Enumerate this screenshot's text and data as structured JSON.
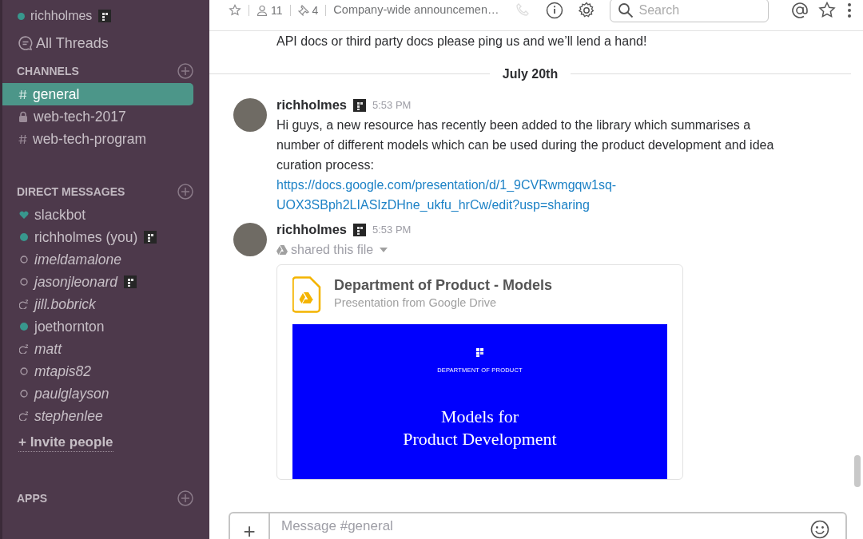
{
  "sidebar": {
    "user": {
      "name": "richholmes",
      "online": true,
      "badge": true
    },
    "all_threads": "All Threads",
    "channels_header": "CHANNELS",
    "channels": [
      {
        "name": "general",
        "kind": "public",
        "selected": true
      },
      {
        "name": "web-tech-2017",
        "kind": "private",
        "selected": false
      },
      {
        "name": "web-tech-program",
        "kind": "public",
        "selected": false
      }
    ],
    "dm_header": "DIRECT MESSAGES",
    "direct_messages": [
      {
        "name": "slackbot",
        "kind": "bot",
        "badge": false
      },
      {
        "name": "richholmes (you)",
        "kind": "active",
        "badge": true
      },
      {
        "name": "imeldamalone",
        "kind": "away",
        "badge": false
      },
      {
        "name": "jasonjleonard",
        "kind": "away",
        "badge": true
      },
      {
        "name": "jill.bobrick",
        "kind": "snoozed",
        "badge": false
      },
      {
        "name": "joethornton",
        "kind": "active",
        "badge": false
      },
      {
        "name": "matt",
        "kind": "snoozed",
        "badge": false
      },
      {
        "name": "mtapis82",
        "kind": "away",
        "badge": false
      },
      {
        "name": "paulglayson",
        "kind": "away",
        "badge": false
      },
      {
        "name": "stephenlee",
        "kind": "snoozed",
        "badge": false
      }
    ],
    "invite": {
      "icon": "+",
      "label": "Invite people"
    },
    "apps_header": "APPS"
  },
  "header": {
    "members": "11",
    "pins": "4",
    "topic": "Company-wide announcemen…",
    "search_placeholder": "Search"
  },
  "messages": {
    "partial_text": "API docs or third party docs please ping us and we’ll lend a hand!",
    "date_divider": "July 20th",
    "items": [
      {
        "kind": "text",
        "author": "richholmes",
        "time": "5:53 PM",
        "text": "Hi guys, a new resource has recently been added to the library which summarises a number of different models which can be used during the product development and idea curation process: ",
        "link": "https://docs.google.com/presentation/d/1_9CVRwmgqw1sq-UOX3SBph2LIASIzDHne_ukfu_hrCw/edit?usp=sharing"
      },
      {
        "kind": "file",
        "author": "richholmes",
        "time": "5:53 PM",
        "action": "shared this file",
        "file_title": "Department of Product - Models",
        "file_source": "Presentation from Google Drive",
        "slide_kicker": "DEPARTMENT OF PRODUCT",
        "slide_title_1": "Models for",
        "slide_title_2": "Product Development"
      }
    ]
  },
  "composer": {
    "add_icon": "+",
    "placeholder": "Message #general"
  }
}
